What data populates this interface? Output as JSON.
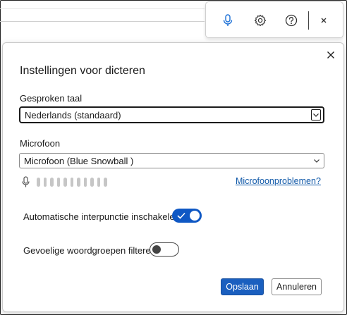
{
  "toolbar": {
    "mic_icon": "microphone-icon",
    "settings_icon": "gear-icon",
    "help_icon": "question-circle-icon",
    "close_icon": "close-icon",
    "accent": "#1a6fd6"
  },
  "dialog": {
    "title": "Instellingen voor dicteren",
    "close_icon": "close-icon",
    "language": {
      "label": "Gesproken taal",
      "value": "Nederlands (standaard)"
    },
    "microphone": {
      "label": "Microfoon",
      "value": "Microfoon (Blue Snowball )",
      "level_icon": "microphone-icon",
      "problems_link": "Microfoonproblemen?"
    },
    "auto_punctuation": {
      "label": "Automatische interpunctie inschakelen",
      "enabled": true
    },
    "sensitive_filter": {
      "label": "Gevoelige woordgroepen filteren",
      "enabled": false
    },
    "buttons": {
      "save": "Opslaan",
      "cancel": "Annuleren"
    },
    "colors": {
      "primary": "#1a5fbf",
      "toggle_on": "#0f58c4",
      "link": "#0f58a8"
    }
  }
}
